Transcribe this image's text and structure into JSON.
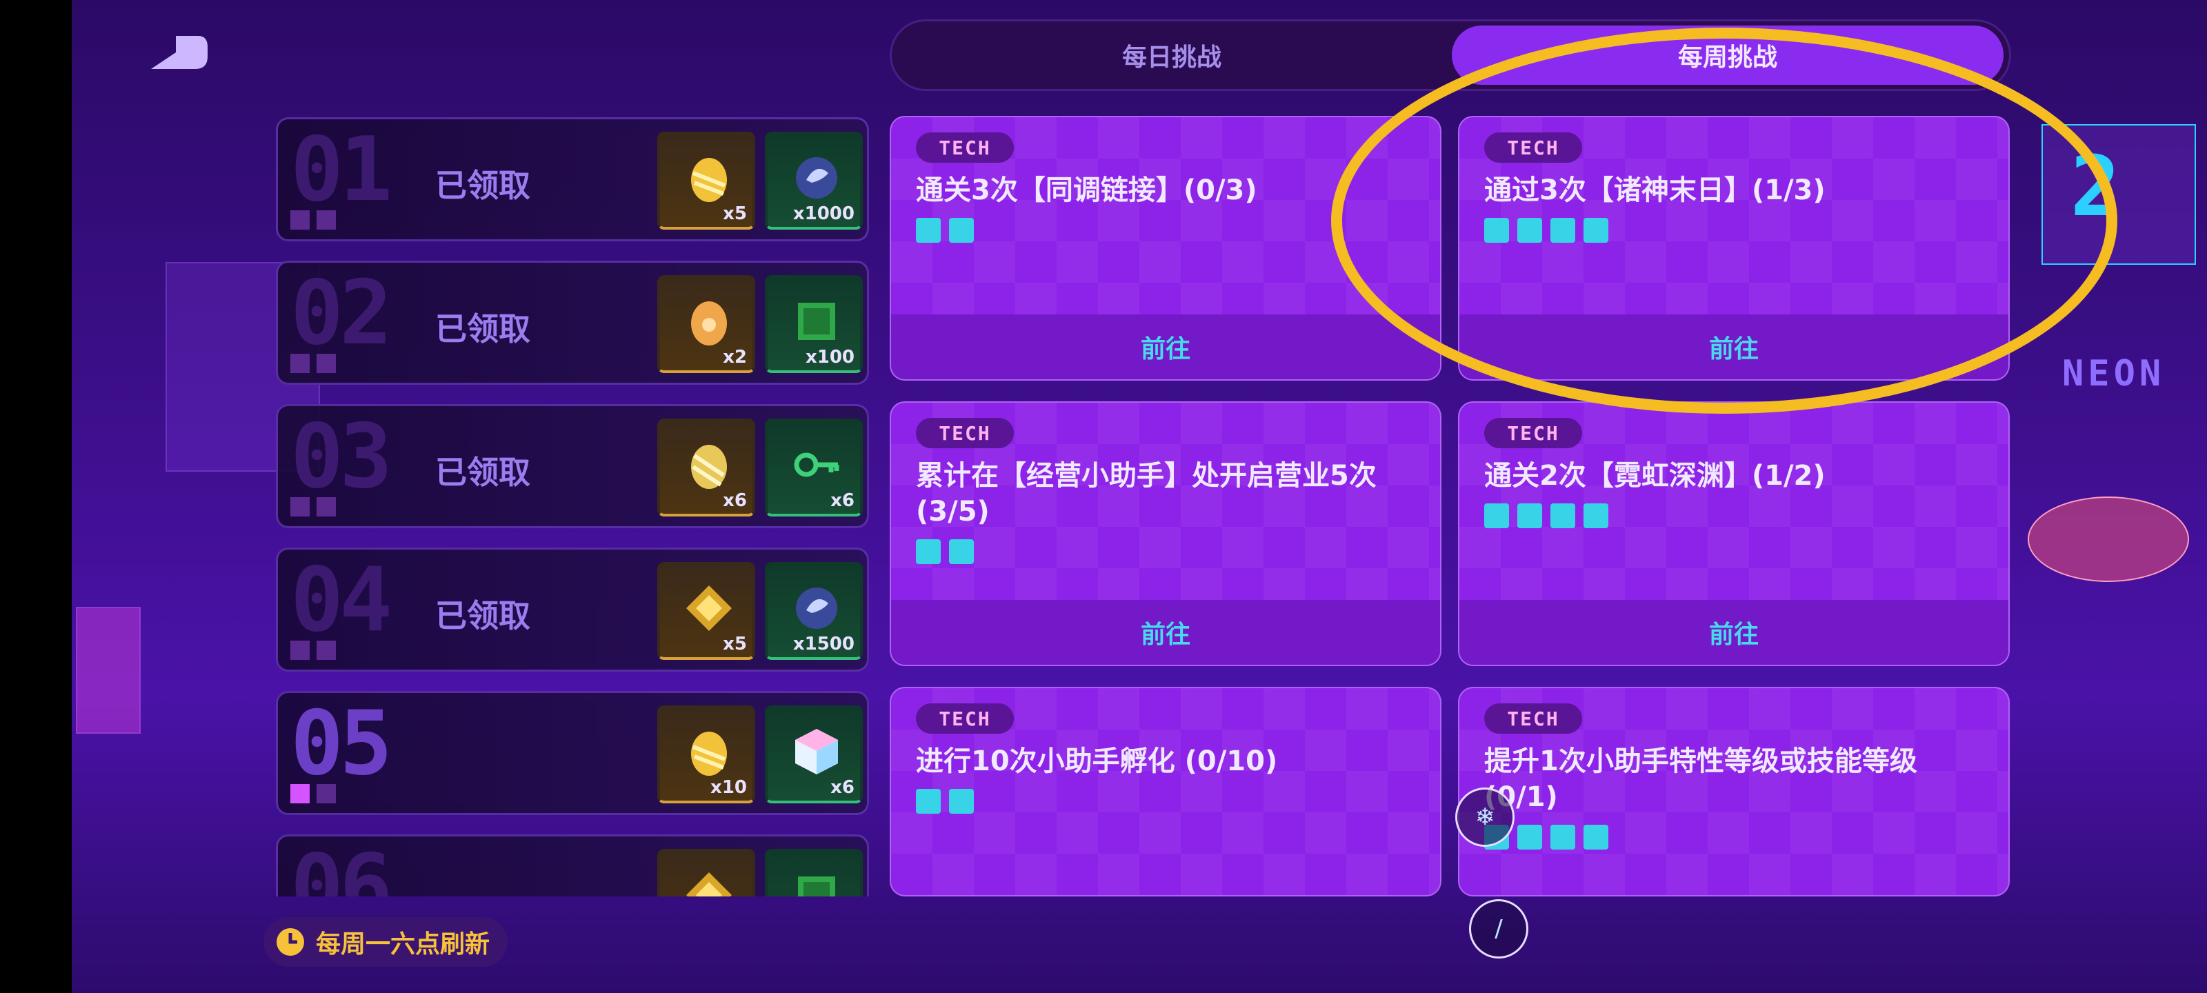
{
  "tabs": {
    "daily": "每日挑战",
    "weekly": "每周挑战",
    "active": "weekly"
  },
  "rewards": [
    {
      "number": "01",
      "status": "已领取",
      "pips_on": 0,
      "items": [
        {
          "icon": "golden-egg-icon",
          "qty": "x5"
        },
        {
          "icon": "blue-orb-icon",
          "qty": "x1000"
        }
      ]
    },
    {
      "number": "02",
      "status": "已领取",
      "pips_on": 0,
      "items": [
        {
          "icon": "orange-egg-icon",
          "qty": "x2"
        },
        {
          "icon": "green-cube-icon",
          "qty": "x100"
        }
      ]
    },
    {
      "number": "03",
      "status": "已领取",
      "pips_on": 0,
      "items": [
        {
          "icon": "striped-egg-icon",
          "qty": "x6"
        },
        {
          "icon": "green-key-icon",
          "qty": "x6"
        }
      ]
    },
    {
      "number": "04",
      "status": "已领取",
      "pips_on": 0,
      "items": [
        {
          "icon": "gold-gem-icon",
          "qty": "x5"
        },
        {
          "icon": "blue-orb-icon",
          "qty": "x1500"
        }
      ]
    },
    {
      "number": "05",
      "status": "",
      "pips_on": 1,
      "items": [
        {
          "icon": "golden-egg-icon",
          "qty": "x10"
        },
        {
          "icon": "crystal-cube-icon",
          "qty": "x6"
        }
      ]
    },
    {
      "number": "06",
      "status": "",
      "pips_on": 0,
      "items": [
        {
          "icon": "gold-gem-icon",
          "qty": ""
        },
        {
          "icon": "green-cube-icon",
          "qty": ""
        }
      ]
    }
  ],
  "challenges": [
    {
      "tag": "TECH",
      "title": "通关3次【同调链接】(0/3)",
      "difficulty": 2,
      "action": "前往"
    },
    {
      "tag": "TECH",
      "title": "通过3次【诸神末日】(1/3)",
      "difficulty": 4,
      "action": "前往"
    },
    {
      "tag": "TECH",
      "title": "累计在【经营小助手】处开启营业5次(3/5)",
      "difficulty": 2,
      "action": "前往"
    },
    {
      "tag": "TECH",
      "title": "通关2次【霓虹深渊】(1/2)",
      "difficulty": 4,
      "action": "前往"
    },
    {
      "tag": "TECH",
      "title": "进行10次小助手孵化 (0/10)",
      "difficulty": 2,
      "action": ""
    },
    {
      "tag": "TECH",
      "title": "提升1次小助手特性等级或技能等级(0/1)",
      "difficulty": 4,
      "action": ""
    }
  ],
  "refresh_text": "每周一六点刷新",
  "background": {
    "sign": "NEON",
    "counter": "2"
  },
  "colors": {
    "accent": "#8a2cf0",
    "highlight": "#f5bd22",
    "card": "#8d22e8",
    "go_text": "#49d9ee",
    "difficulty": "#39d3e8"
  }
}
